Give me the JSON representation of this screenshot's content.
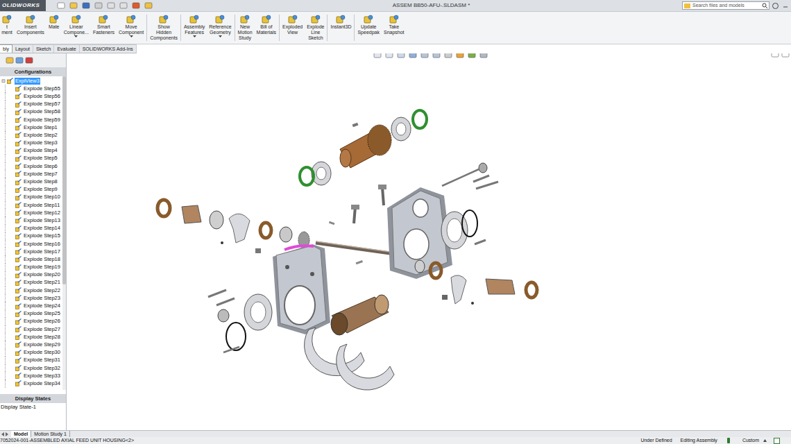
{
  "window": {
    "title": "ASSEM BB50-AFU-.SLDASM *",
    "logo": "OLIDWORKS"
  },
  "search": {
    "placeholder": "Search files and models"
  },
  "ribbon": [
    {
      "lines": [
        "t",
        "ment"
      ],
      "dropdown": false,
      "separator": false
    },
    {
      "lines": [
        "Insert",
        "Components"
      ],
      "dropdown": false,
      "separator": false
    },
    {
      "lines": [
        "Mate"
      ],
      "dropdown": false,
      "separator": false
    },
    {
      "lines": [
        "Linear",
        "Compone..."
      ],
      "dropdown": true,
      "separator": false
    },
    {
      "lines": [
        "Smart",
        "Fasteners"
      ],
      "dropdown": false,
      "separator": false
    },
    {
      "lines": [
        "Move",
        "Component"
      ],
      "dropdown": true,
      "separator": true
    },
    {
      "lines": [
        "Show",
        "Hidden",
        "Components"
      ],
      "dropdown": false,
      "separator": true
    },
    {
      "lines": [
        "Assembly",
        "Features"
      ],
      "dropdown": true,
      "separator": false
    },
    {
      "lines": [
        "Reference",
        "Geometry"
      ],
      "dropdown": true,
      "separator": true
    },
    {
      "lines": [
        "New",
        "Motion",
        "Study"
      ],
      "dropdown": false,
      "separator": false
    },
    {
      "lines": [
        "Bill of",
        "Materials"
      ],
      "dropdown": false,
      "separator": true
    },
    {
      "lines": [
        "Exploded",
        "View"
      ],
      "dropdown": false,
      "separator": false
    },
    {
      "lines": [
        "Explode",
        "Line",
        "Sketch"
      ],
      "dropdown": false,
      "separator": true
    },
    {
      "lines": [
        "Instant3D"
      ],
      "dropdown": false,
      "separator": true
    },
    {
      "lines": [
        "Update",
        "Speedpak"
      ],
      "dropdown": false,
      "separator": false
    },
    {
      "lines": [
        "Take",
        "Snapshot"
      ],
      "dropdown": false,
      "separator": false
    }
  ],
  "tabs": [
    {
      "label": "bly",
      "selected": true
    },
    {
      "label": "Layout",
      "selected": false
    },
    {
      "label": "Sketch",
      "selected": false
    },
    {
      "label": "Evaluate",
      "selected": false
    },
    {
      "label": "SOLIDWORKS Add-Ins",
      "selected": false
    }
  ],
  "sidebar": {
    "configurations_header": "Configurations",
    "root": {
      "label": "ExplView3",
      "selected": true
    },
    "items": [
      "Explode Step55",
      "Explode Step56",
      "Explode Step57",
      "Explode Step58",
      "Explode Step59",
      "Explode Step1",
      "Explode Step2",
      "Explode Step3",
      "Explode Step4",
      "Explode Step5",
      "Explode Step6",
      "Explode Step7",
      "Explode Step8",
      "Explode Step9",
      "Explode Step10",
      "Explode Step11",
      "Explode Step12",
      "Explode Step13",
      "Explode Step14",
      "Explode Step15",
      "Explode Step16",
      "Explode Step17",
      "Explode Step18",
      "Explode Step19",
      "Explode Step20",
      "Explode Step21",
      "Explode Step22",
      "Explode Step23",
      "Explode Step24",
      "Explode Step25",
      "Explode Step26",
      "Explode Step27",
      "Explode Step28",
      "Explode Step29",
      "Explode Step30",
      "Explode Step31",
      "Explode Step32",
      "Explode Step33",
      "Explode Step34"
    ],
    "display_states_header": "Display States",
    "display_states": [
      "Display State-1"
    ]
  },
  "bottom_tabs": [
    {
      "label": "Model",
      "selected": true
    },
    {
      "label": "Motion Study 1",
      "selected": false
    }
  ],
  "status_bar": {
    "left": "7052024-001-ASSEMBLED AXIAL FEED UNIT HOUSING<2>",
    "items": [
      "Under Defined",
      "Editing Assembly"
    ],
    "custom": "Custom"
  }
}
